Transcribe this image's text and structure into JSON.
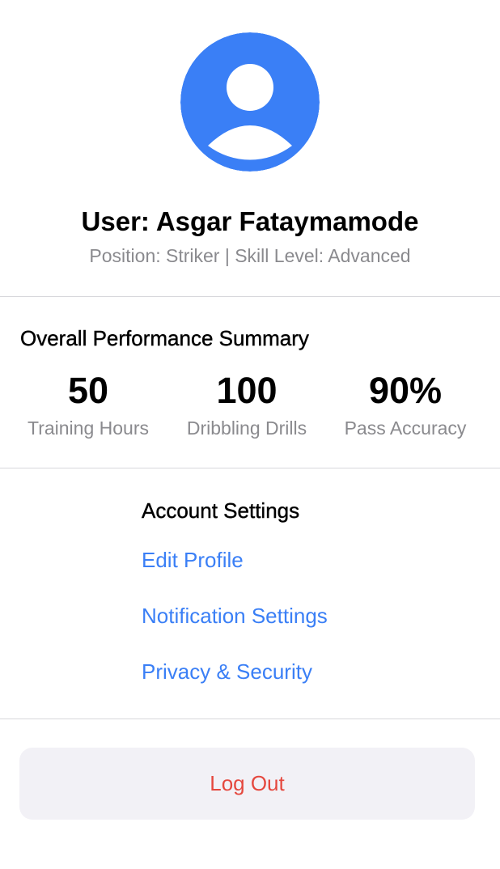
{
  "colors": {
    "accent": "#3a7ff6",
    "secondary_text": "#8a8a8e",
    "logout_text": "#e5483e",
    "logout_bg": "#f2f1f6",
    "divider": "#d8d8dc"
  },
  "profile": {
    "avatar_icon": "person-circle-icon",
    "name": "User: Asgar Fataymamode",
    "meta": "Position: Striker | Skill Level: Advanced"
  },
  "performance": {
    "title": "Overall Performance Summary",
    "stats": [
      {
        "value": "50",
        "label": "Training Hours"
      },
      {
        "value": "100",
        "label": "Dribbling Drills"
      },
      {
        "value": "90%",
        "label": "Pass Accuracy"
      }
    ]
  },
  "account_settings": {
    "title": "Account Settings",
    "links": [
      {
        "label": "Edit Profile"
      },
      {
        "label": "Notification Settings"
      },
      {
        "label": "Privacy & Security"
      }
    ]
  },
  "logout": {
    "label": "Log Out"
  }
}
